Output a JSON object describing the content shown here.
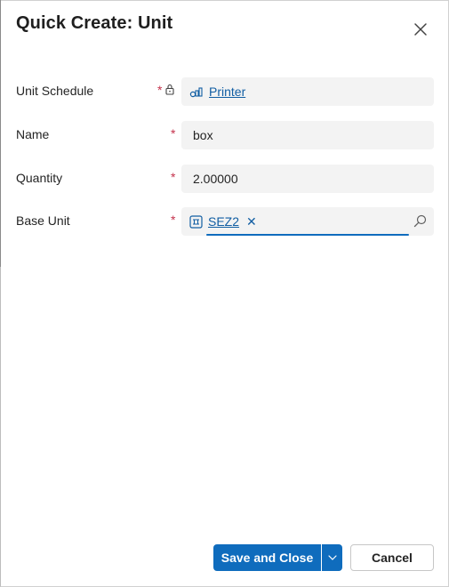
{
  "dialog": {
    "title": "Quick Create: Unit",
    "close_icon": "close-icon"
  },
  "fields": {
    "unit_schedule": {
      "label": "Unit Schedule",
      "required_mark": "*",
      "locked": true,
      "value": "Printer",
      "icon": "entity-icon"
    },
    "name": {
      "label": "Name",
      "required_mark": "*",
      "value": "box"
    },
    "quantity": {
      "label": "Quantity",
      "required_mark": "*",
      "value": "2.00000"
    },
    "base_unit": {
      "label": "Base Unit",
      "required_mark": "*",
      "value": "SEZ2",
      "remove_glyph": "✕",
      "icon": "unit-icon"
    }
  },
  "footer": {
    "save_label": "Save and Close",
    "cancel_label": "Cancel"
  },
  "colors": {
    "accent": "#0f6cbd",
    "link": "#115ea3",
    "required": "#c4314b",
    "field_bg": "#f3f3f3"
  }
}
